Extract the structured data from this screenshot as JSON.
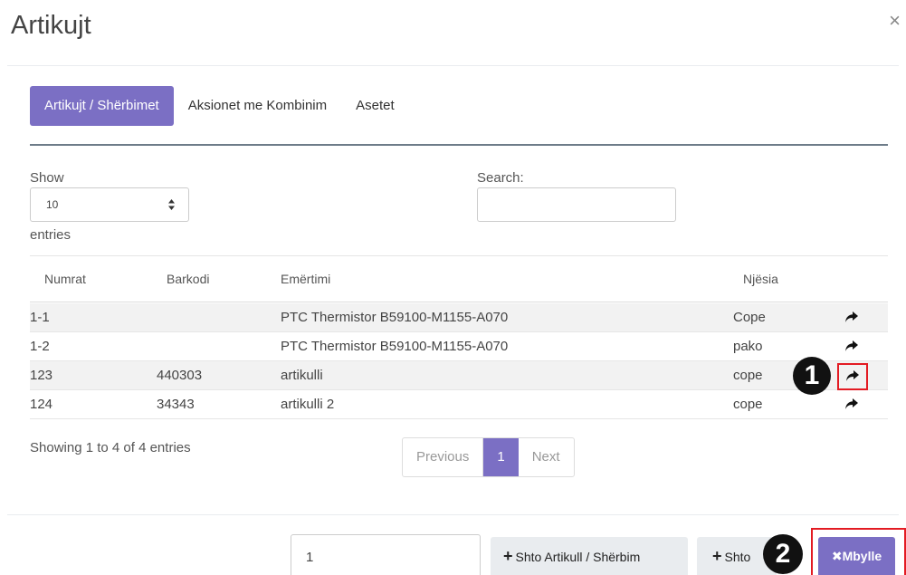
{
  "modal": {
    "title": "Artikujt",
    "close_symbol": "×"
  },
  "tabs": [
    {
      "label": "Artikujt / Shërbimet",
      "active": true
    },
    {
      "label": "Aksionet me Kombinim",
      "active": false
    },
    {
      "label": "Asetet",
      "active": false
    }
  ],
  "length": {
    "show_label": "Show",
    "selected": "10",
    "entries_label": "entries"
  },
  "search": {
    "label": "Search:",
    "value": ""
  },
  "table": {
    "headers": [
      "Numrat",
      "Barkodi",
      "Emërtimi",
      "Njësia"
    ],
    "rows": [
      {
        "numrat": "1-1",
        "barkodi": "",
        "emertimi": "PTC Thermistor B59100-M1155-A070",
        "njesia": "Cope"
      },
      {
        "numrat": "1-2",
        "barkodi": "",
        "emertimi": "PTC Thermistor B59100-M1155-A070",
        "njesia": "pako"
      },
      {
        "numrat": "123",
        "barkodi": "440303",
        "emertimi": "artikulli",
        "njesia": "cope"
      },
      {
        "numrat": "124",
        "barkodi": "34343",
        "emertimi": "artikulli 2",
        "njesia": "cope"
      }
    ]
  },
  "info": "Showing 1 to 4 of 4 entries",
  "pagination": {
    "previous": "Previous",
    "current": "1",
    "next": "Next"
  },
  "footer": {
    "quantity_value": "1",
    "add_item_label": "Shto Artikull / Shërbim",
    "add_label": "Shto",
    "close_label": "Mbylle"
  },
  "annotations": {
    "badge1": "1",
    "badge2": "2",
    "highlight_color": "#e31b23"
  },
  "colors": {
    "accent": "#7b6fc4"
  },
  "icons": {
    "row_action": "share-arrow-icon",
    "close": "close-icon",
    "plus": "plus-icon",
    "x": "x-icon"
  }
}
